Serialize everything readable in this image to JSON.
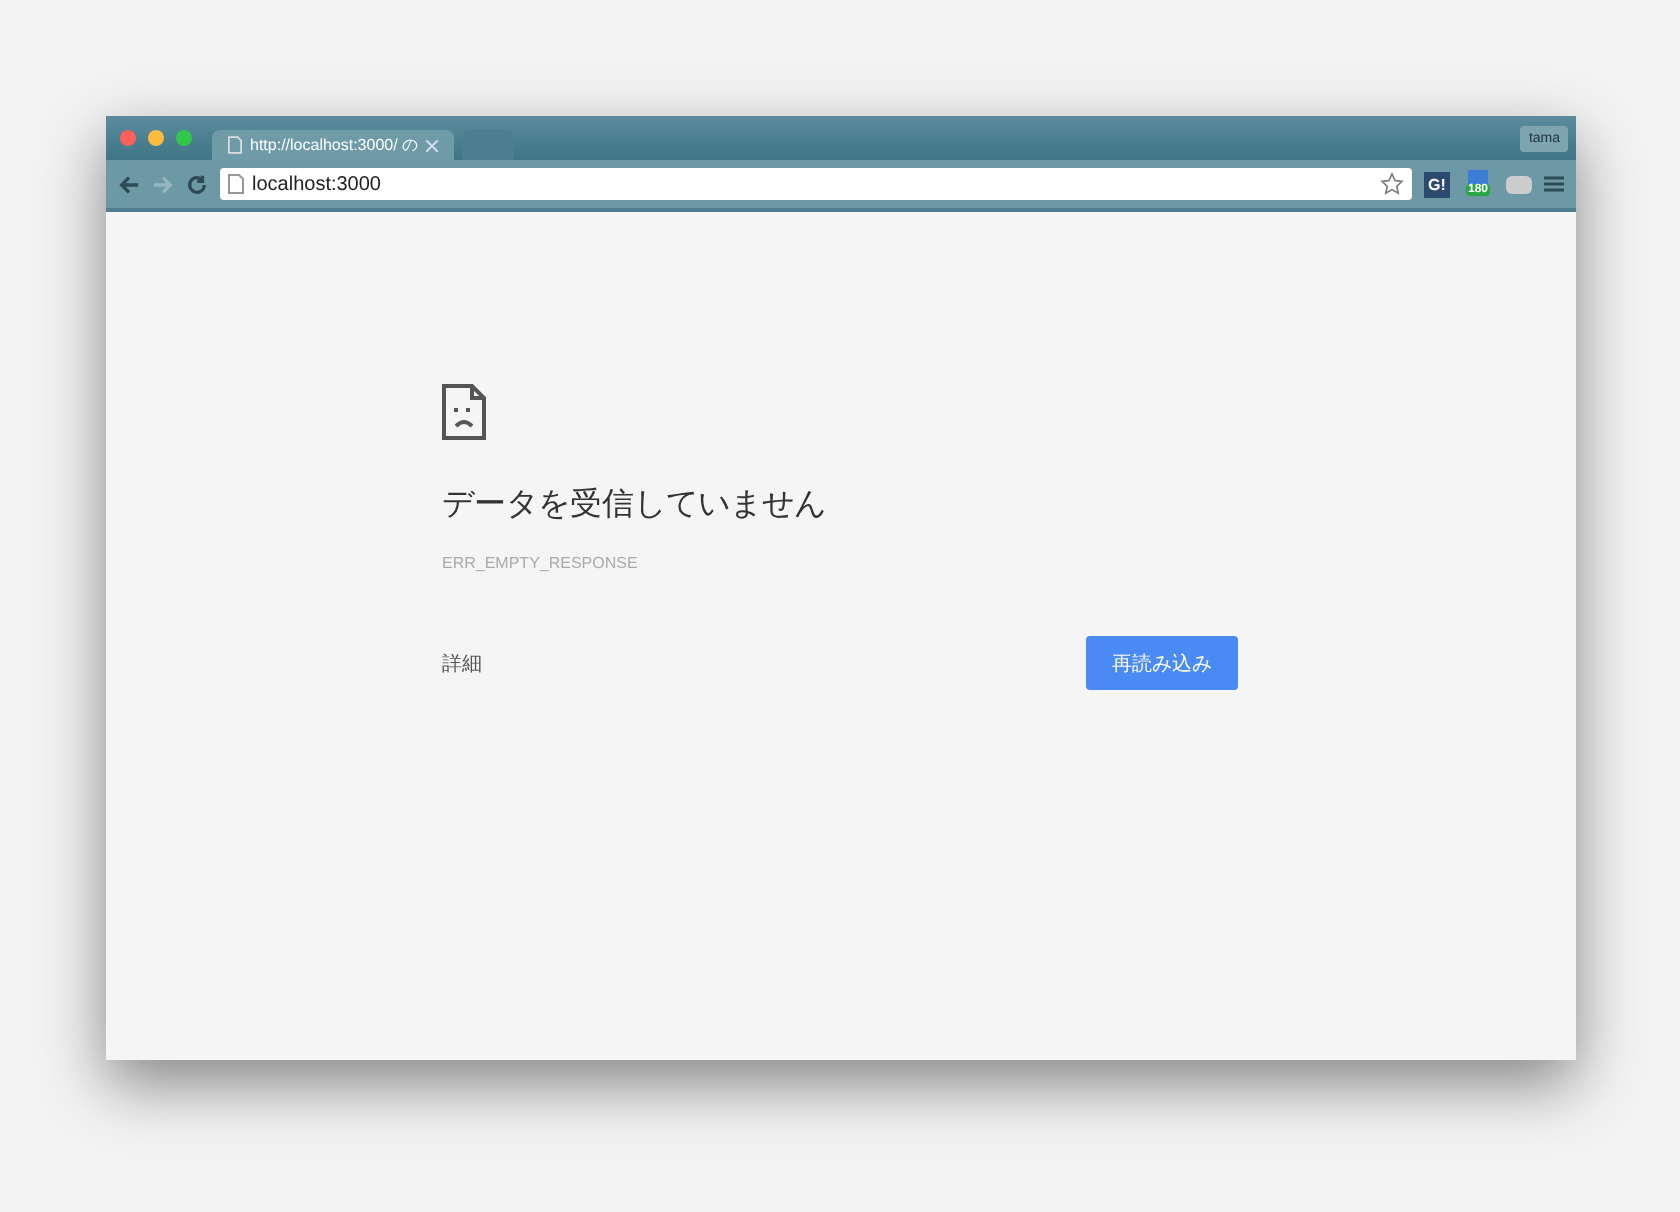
{
  "window": {
    "profile": "tama"
  },
  "tabs": [
    {
      "title": "http://localhost:3000/ の",
      "selected": true
    },
    {
      "selected": false
    }
  ],
  "toolbar": {
    "address": "localhost:3000",
    "bookmarked": false,
    "extensions": [
      {
        "kind": "label",
        "text": "G!"
      },
      {
        "kind": "badge",
        "text": "180"
      },
      {
        "kind": "plain"
      }
    ]
  },
  "error": {
    "heading": "データを受信していません",
    "code": "ERR_EMPTY_RESPONSE",
    "details_link": "詳細",
    "reload_button": "再読み込み"
  }
}
